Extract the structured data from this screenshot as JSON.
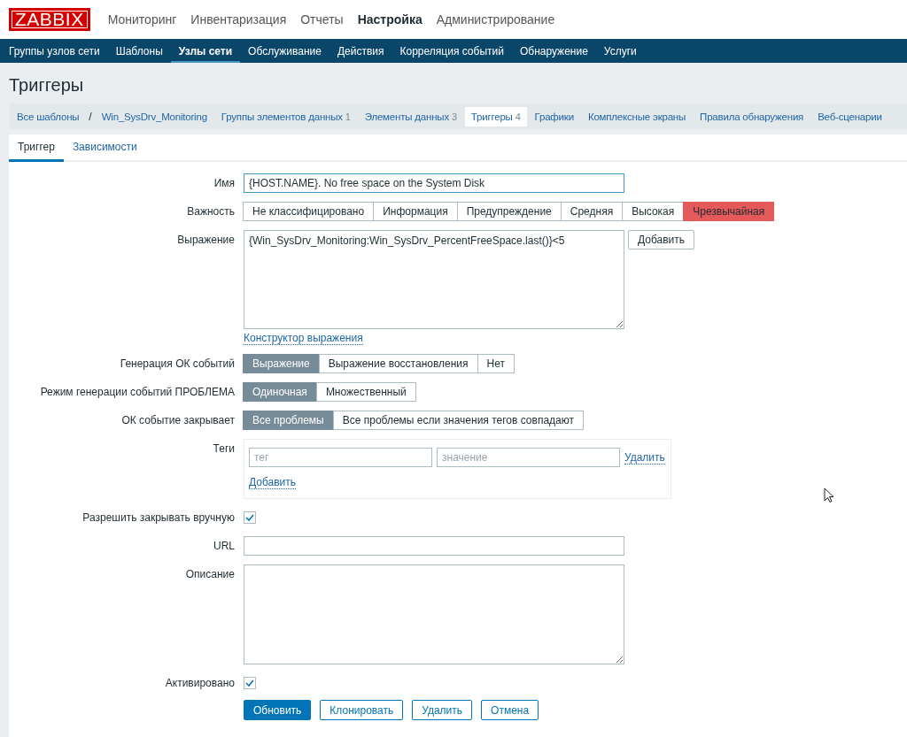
{
  "header": {
    "logo": "ZABBIX",
    "menu": [
      {
        "label": "Мониторинг",
        "selected": false
      },
      {
        "label": "Инвентаризация",
        "selected": false
      },
      {
        "label": "Отчеты",
        "selected": false
      },
      {
        "label": "Настройка",
        "selected": true
      },
      {
        "label": "Администрирование",
        "selected": false
      }
    ]
  },
  "submenu": [
    {
      "label": "Группы узлов сети",
      "selected": false
    },
    {
      "label": "Шаблоны",
      "selected": false
    },
    {
      "label": "Узлы сети",
      "selected": true
    },
    {
      "label": "Обслуживание",
      "selected": false
    },
    {
      "label": "Действия",
      "selected": false
    },
    {
      "label": "Корреляция событий",
      "selected": false
    },
    {
      "label": "Обнаружение",
      "selected": false
    },
    {
      "label": "Услуги",
      "selected": false
    }
  ],
  "page_title": "Триггеры",
  "breadcrumbs": [
    {
      "label": "Все шаблоны",
      "selected": false
    },
    {
      "label": "/",
      "kind": "separator"
    },
    {
      "label": "Win_SysDrv_Monitoring",
      "selected": false
    },
    {
      "label": "Группы элементов данных",
      "count": "1",
      "selected": false
    },
    {
      "label": "Элементы данных",
      "count": "3",
      "selected": false
    },
    {
      "label": "Триггеры",
      "count": "4",
      "selected": true
    },
    {
      "label": "Графики",
      "selected": false
    },
    {
      "label": "Комплексные экраны",
      "selected": false
    },
    {
      "label": "Правила обнаружения",
      "selected": false
    },
    {
      "label": "Веб-сценарии",
      "selected": false
    }
  ],
  "form_tabs": [
    {
      "label": "Триггер",
      "selected": true
    },
    {
      "label": "Зависимости",
      "selected": false
    }
  ],
  "form": [
    {
      "kind": "text",
      "label": "Имя",
      "value": "{HOST.NAME}. No free space on the System Disk"
    },
    {
      "kind": "severity",
      "label": "Важность",
      "options": [
        {
          "label": "Не классифицировано",
          "selected": false
        },
        {
          "label": "Информация",
          "selected": false
        },
        {
          "label": "Предупреждение",
          "selected": false
        },
        {
          "label": "Средняя",
          "selected": false
        },
        {
          "label": "Высокая",
          "selected": false
        },
        {
          "label": "Чрезвычайная",
          "selected": true
        }
      ]
    },
    {
      "kind": "expression",
      "label": "Выражение",
      "value": "{Win_SysDrv_Monitoring:Win_SysDrv_PercentFreeSpace.last()}<5",
      "button": "Добавить",
      "link": "Конструктор выражения"
    },
    {
      "kind": "segmented",
      "label": "Генерация ОК событий",
      "options": [
        {
          "label": "Выражение",
          "selected": true
        },
        {
          "label": "Выражение восстановления",
          "selected": false
        },
        {
          "label": "Нет",
          "selected": false
        }
      ]
    },
    {
      "kind": "segmented",
      "label": "Режим генерации событий ПРОБЛЕМА",
      "options": [
        {
          "label": "Одиночная",
          "selected": true
        },
        {
          "label": "Множественный",
          "selected": false
        }
      ]
    },
    {
      "kind": "segmented",
      "label": "ОК событие закрывает",
      "options": [
        {
          "label": "Все проблемы",
          "selected": true
        },
        {
          "label": "Все проблемы если значения тегов совпадают",
          "selected": false
        }
      ]
    },
    {
      "kind": "tags",
      "label": "Теги",
      "tag_placeholder": "тег",
      "value_placeholder": "значение",
      "remove": "Удалить",
      "add": "Добавить"
    },
    {
      "kind": "checkbox",
      "label": "Разрешить закрывать вручную",
      "checked": true
    },
    {
      "kind": "text",
      "label": "URL"
    },
    {
      "kind": "textarea",
      "label": "Описание"
    },
    {
      "kind": "checkbox",
      "label": "Активировано",
      "checked": true
    }
  ],
  "buttons": [
    {
      "label": "Обновить",
      "kind": "primary"
    },
    {
      "label": "Клонировать",
      "kind": "secondary"
    },
    {
      "label": "Удалить",
      "kind": "secondary"
    },
    {
      "label": "Отмена",
      "kind": "secondary"
    }
  ]
}
